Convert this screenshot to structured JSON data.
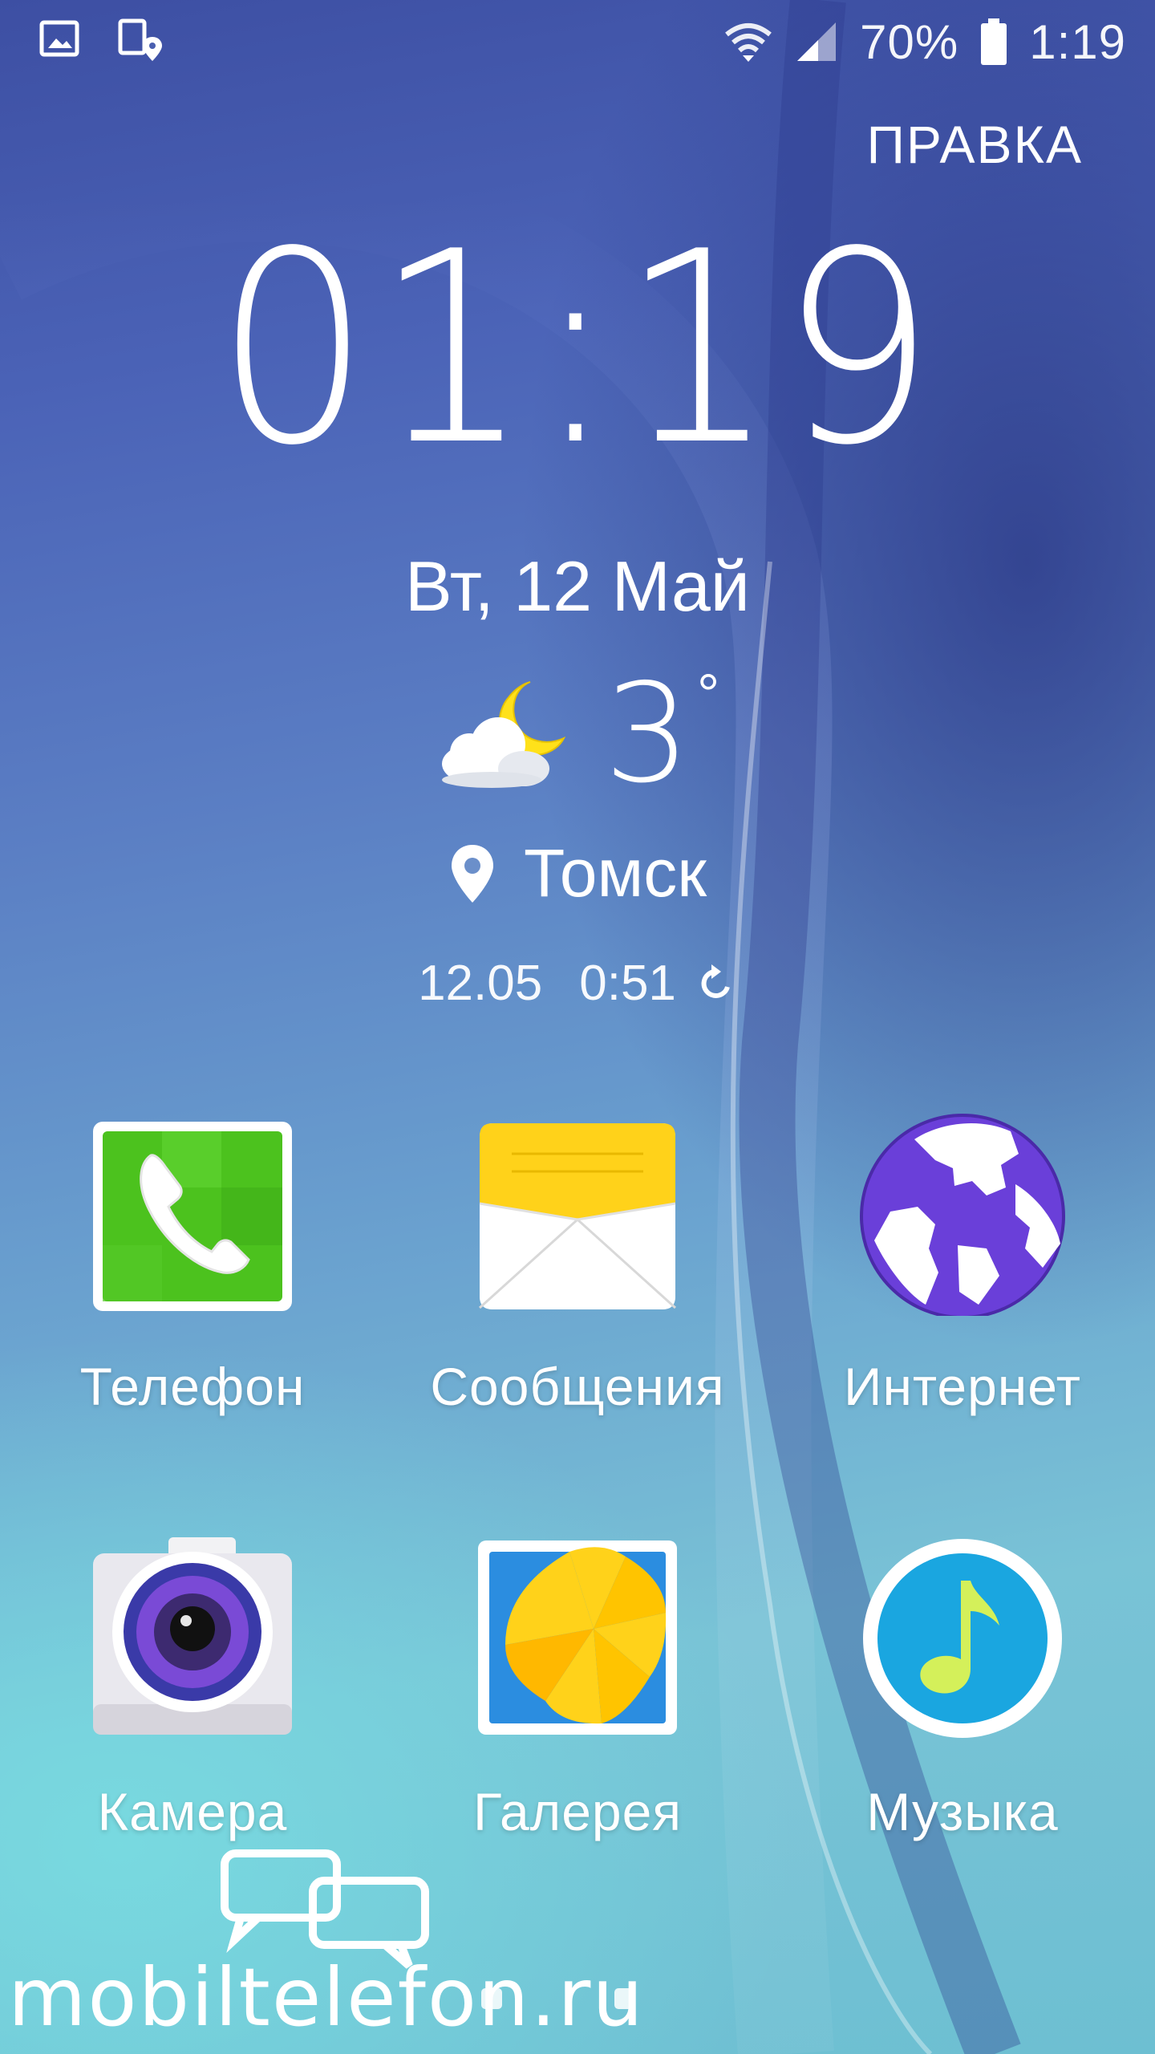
{
  "status_bar": {
    "battery_percent": "70%",
    "time": "1:19",
    "left_icons": [
      "gallery-notification-icon",
      "location-device-icon"
    ],
    "right_icons": [
      "wifi-icon",
      "signal-icon",
      "battery-icon"
    ]
  },
  "edit_label": "ПРАВКА",
  "clock": {
    "time": "01:19",
    "date": "Вт, 12 Май"
  },
  "weather": {
    "temperature": "3",
    "degree_symbol": "°",
    "condition_icon": "cloud-moon-icon",
    "city": "Томск",
    "updated_date": "12.05",
    "updated_time": "0:51"
  },
  "apps": [
    {
      "label": "Телефон",
      "icon": "phone-icon"
    },
    {
      "label": "Сообщения",
      "icon": "messages-icon"
    },
    {
      "label": "Интернет",
      "icon": "internet-icon"
    },
    {
      "label": "Камера",
      "icon": "camera-icon"
    },
    {
      "label": "Галерея",
      "icon": "gallery-icon"
    },
    {
      "label": "Музыка",
      "icon": "music-icon"
    }
  ],
  "watermark": {
    "text": "mobiltelefon.ru"
  },
  "colors": {
    "phone_green": "#4cc21e",
    "messages_yellow": "#ffd21a",
    "internet_purple": "#6a3fd9",
    "music_blue": "#1aa6e0",
    "music_note": "#d4f05a"
  }
}
